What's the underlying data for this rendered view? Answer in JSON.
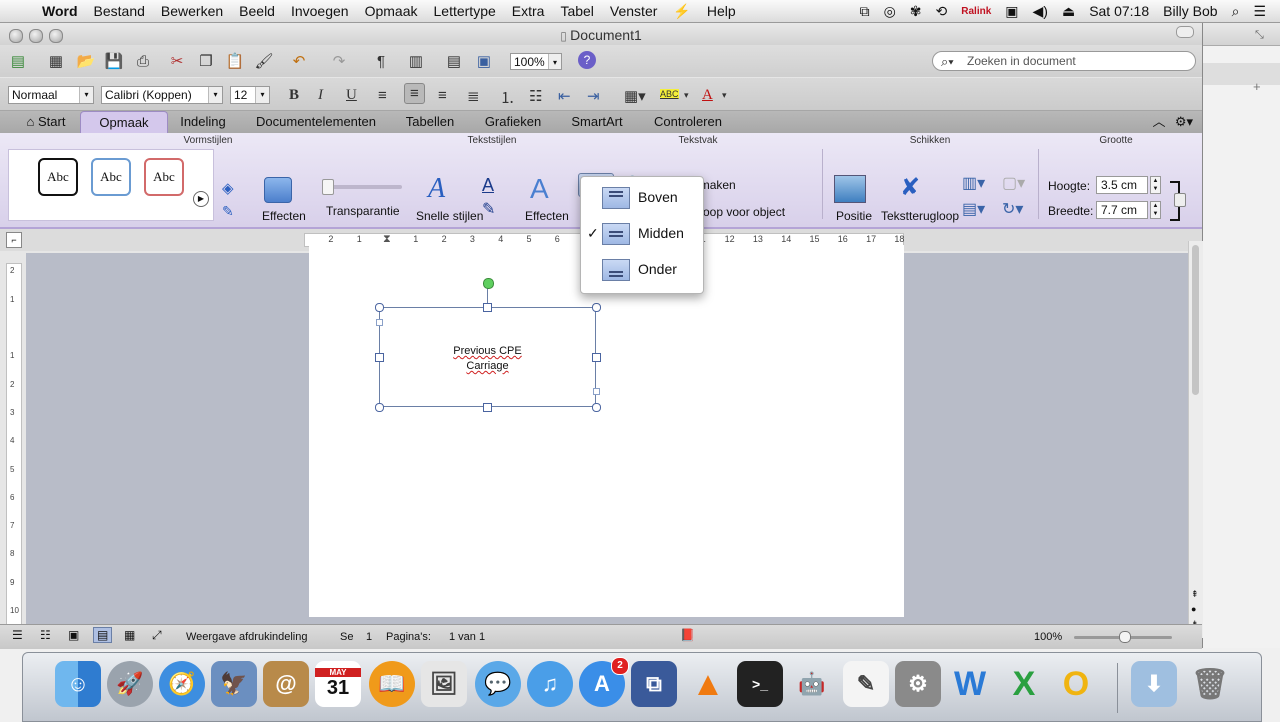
{
  "menubar": {
    "app": "Word",
    "items": [
      "Bestand",
      "Bewerken",
      "Beeld",
      "Invoegen",
      "Opmaak",
      "Lettertype",
      "Extra",
      "Tabel",
      "Venster",
      "Help"
    ],
    "status_ralink": "Ralink",
    "clock": "Sat 07:18",
    "user": "Billy Bob"
  },
  "window": {
    "title": "Document1"
  },
  "toolbar": {
    "zoom": "100%",
    "search_placeholder": "Zoeken in document"
  },
  "format_bar": {
    "style": "Normaal",
    "font": "Calibri (Koppen)",
    "size": "12"
  },
  "ribbon_tabs": [
    "Start",
    "Opmaak",
    "Indeling",
    "Documentelementen",
    "Tabellen",
    "Grafieken",
    "SmartArt",
    "Controleren"
  ],
  "ribbon": {
    "groups": {
      "vormstijlen": "Vormstijlen",
      "tekststijlen": "Tekststijlen",
      "tekstvak": "Tekstvak",
      "schikken": "Schikken",
      "grootte": "Grootte"
    },
    "abc_samples": [
      "Abc",
      "Abc",
      "Abc"
    ],
    "effecten_shape": "Effecten",
    "transparantie": "Transparantie",
    "snelle_stijlen": "Snelle stijlen",
    "effecten_text": "Effecten",
    "koppeling_maken": "Koppeling maken",
    "doorloop_partial": "oop voor object",
    "positie": "Positie",
    "tekstterugloop": "Tekstterugloop",
    "hoogte_label": "Hoogte:",
    "hoogte_value": "3.5 cm",
    "breedte_label": "Breedte:",
    "breedte_value": "7.7 cm"
  },
  "ruler_numbers": [
    "2",
    "1",
    "1",
    "2",
    "3",
    "4",
    "5",
    "6",
    "7",
    "8",
    "9",
    "10",
    "11",
    "12",
    "13",
    "14",
    "15",
    "16",
    "17",
    "18"
  ],
  "vruler_numbers": [
    "2",
    "1",
    "1",
    "2",
    "3",
    "4",
    "5",
    "6",
    "7",
    "8",
    "9",
    "10"
  ],
  "textbox": {
    "line1": "Previous CPE",
    "line2": "Carriage"
  },
  "dropdown": {
    "items": [
      {
        "label": "Boven",
        "checked": false
      },
      {
        "label": "Midden",
        "checked": true
      },
      {
        "label": "Onder",
        "checked": false
      }
    ],
    "check_mark": "✓"
  },
  "statusbar": {
    "view": "Weergave afdrukindeling",
    "section_label": "Se",
    "section_value": "1",
    "pages_label": "Pagina's:",
    "pages_value": "1 van 1",
    "zoom": "100%"
  },
  "dock": {
    "ical_month": "MAY",
    "ical_day": "31",
    "appstore_badge": "2"
  }
}
